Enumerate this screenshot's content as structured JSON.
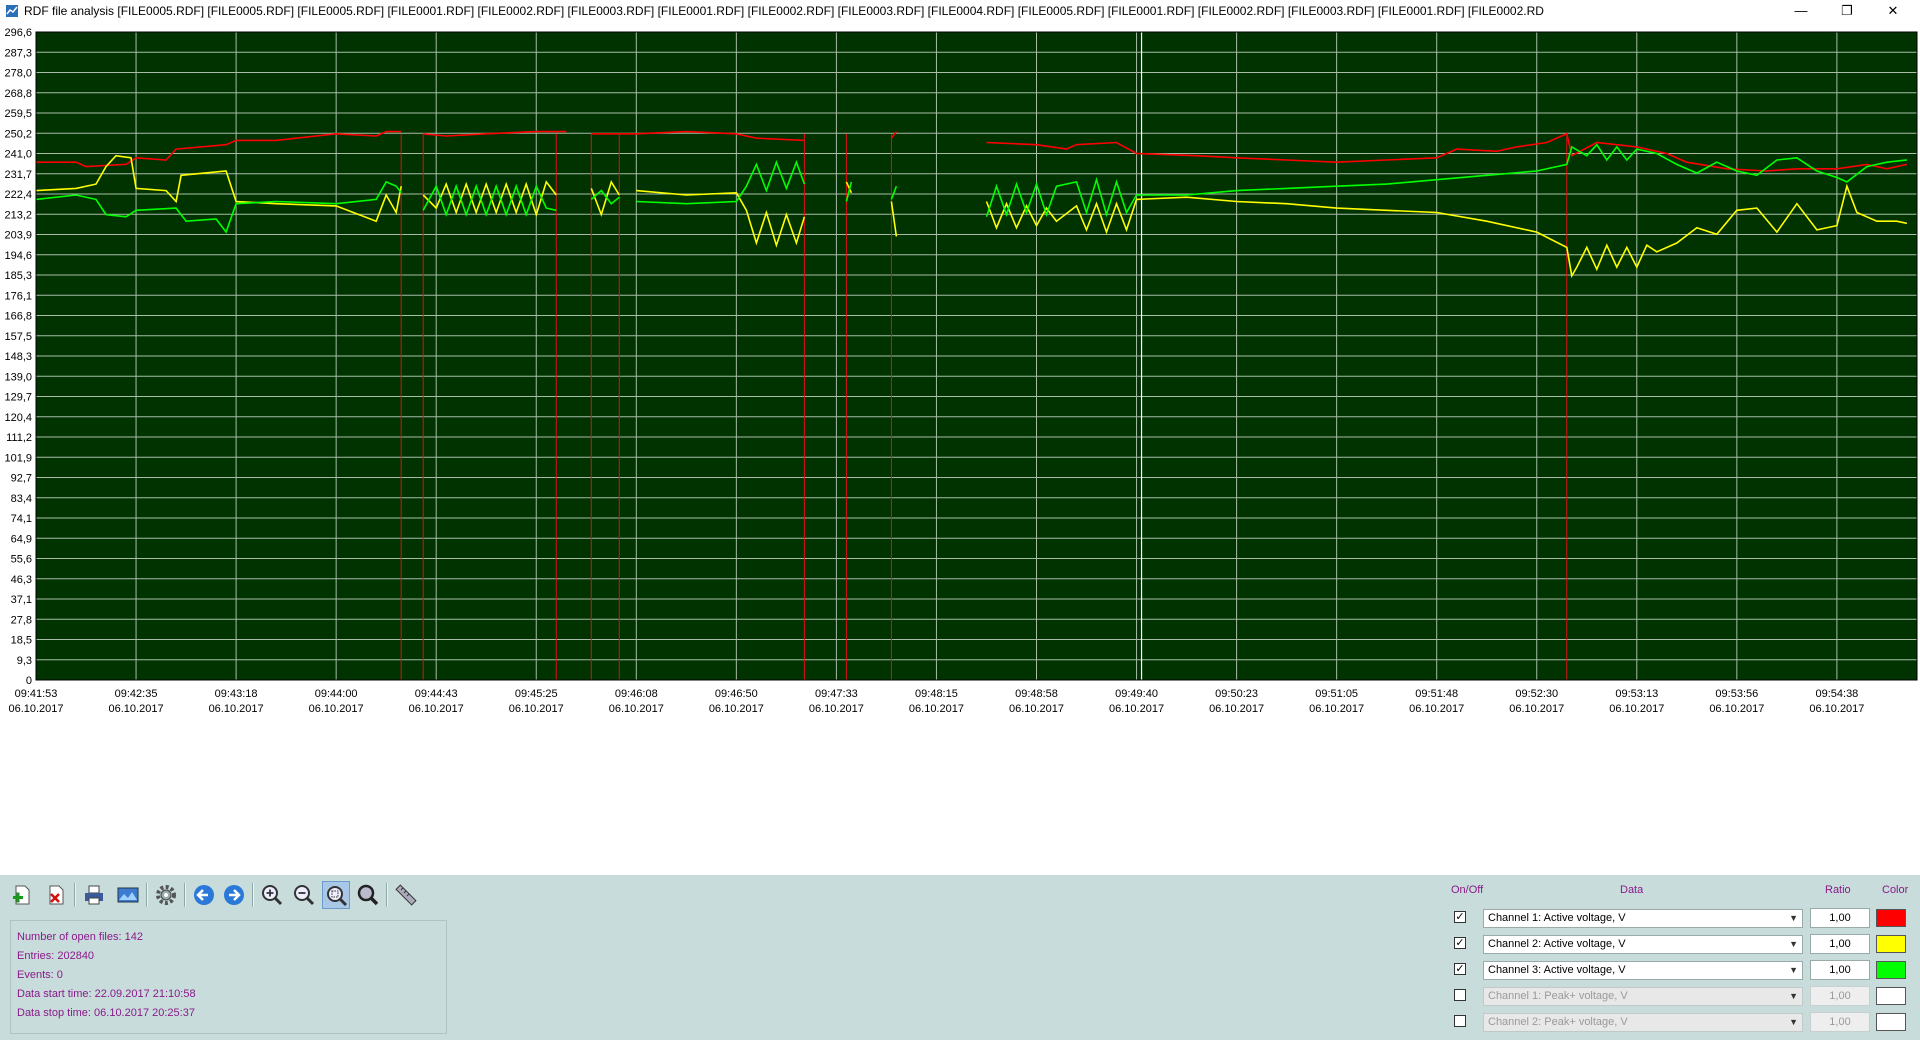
{
  "window": {
    "title": "RDF file analysis [FILE0005.RDF] [FILE0005.RDF] [FILE0005.RDF] [FILE0001.RDF] [FILE0002.RDF] [FILE0003.RDF] [FILE0001.RDF] [FILE0002.RDF] [FILE0003.RDF] [FILE0004.RDF] [FILE0005.RDF] [FILE0001.RDF] [FILE0002.RDF] [FILE0003.RDF] [FILE0001.RDF] [FILE0002.RD",
    "minimize_glyph": "—",
    "restore_glyph": "❐",
    "close_glyph": "✕"
  },
  "chart_data": {
    "type": "line",
    "background": "#003300",
    "grid": true,
    "grid_color": "#a8bca8",
    "ylim": [
      0,
      296.6
    ],
    "y_ticks": [
      "296,6",
      "287,3",
      "278,0",
      "268,8",
      "259,5",
      "250,2",
      "241,0",
      "231,7",
      "222,4",
      "213,2",
      "203,9",
      "194,6",
      "185,3",
      "176,1",
      "166,8",
      "157,5",
      "148,3",
      "139,0",
      "129,7",
      "120,4",
      "111,2",
      "101,9",
      "92,7",
      "83,4",
      "74,1",
      "64,9",
      "55,6",
      "46,3",
      "37,1",
      "27,8",
      "18,5",
      "9,3",
      "0"
    ],
    "x_ticks": [
      {
        "time": "09:41:53",
        "date": "06.10.2017"
      },
      {
        "time": "09:42:35",
        "date": "06.10.2017"
      },
      {
        "time": "09:43:18",
        "date": "06.10.2017"
      },
      {
        "time": "09:44:00",
        "date": "06.10.2017"
      },
      {
        "time": "09:44:43",
        "date": "06.10.2017"
      },
      {
        "time": "09:45:25",
        "date": "06.10.2017"
      },
      {
        "time": "09:46:08",
        "date": "06.10.2017"
      },
      {
        "time": "09:46:50",
        "date": "06.10.2017"
      },
      {
        "time": "09:47:33",
        "date": "06.10.2017"
      },
      {
        "time": "09:48:15",
        "date": "06.10.2017"
      },
      {
        "time": "09:48:58",
        "date": "06.10.2017"
      },
      {
        "time": "09:49:40",
        "date": "06.10.2017"
      },
      {
        "time": "09:50:23",
        "date": "06.10.2017"
      },
      {
        "time": "09:51:05",
        "date": "06.10.2017"
      },
      {
        "time": "09:51:48",
        "date": "06.10.2017"
      },
      {
        "time": "09:52:30",
        "date": "06.10.2017"
      },
      {
        "time": "09:53:13",
        "date": "06.10.2017"
      },
      {
        "time": "09:53:56",
        "date": "06.10.2017"
      },
      {
        "time": "09:54:38",
        "date": "06.10.2017"
      }
    ],
    "x_range_tick_units": [
      0,
      18.7
    ],
    "cursor_at_tick": 11.05,
    "event_markers_at_tick": [
      3.65,
      3.87,
      5.2,
      5.55,
      5.83,
      7.68,
      8.1,
      8.55,
      15.3
    ],
    "series": [
      {
        "name": "Channel 1: Active voltage, V",
        "color": "#ff0000",
        "points": [
          [
            0,
            237
          ],
          [
            0.4,
            237
          ],
          [
            0.5,
            235
          ],
          [
            0.9,
            236
          ],
          [
            1.0,
            239
          ],
          [
            1.3,
            238
          ],
          [
            1.4,
            243
          ],
          [
            1.9,
            245
          ],
          [
            2.0,
            247
          ],
          [
            2.4,
            247
          ],
          [
            2.6,
            248
          ],
          [
            3.0,
            250
          ],
          [
            3.4,
            249
          ],
          [
            3.5,
            251
          ],
          [
            3.65,
            251
          ],
          null,
          [
            3.87,
            250
          ],
          [
            4.1,
            249
          ],
          [
            4.5,
            250
          ],
          [
            5.0,
            251
          ],
          [
            5.3,
            251
          ],
          null,
          [
            5.55,
            250
          ],
          [
            6.0,
            250
          ],
          [
            6.5,
            251
          ],
          [
            7.0,
            250
          ],
          [
            7.2,
            248
          ],
          [
            7.68,
            247
          ],
          null,
          [
            8.55,
            248
          ],
          [
            8.6,
            251
          ],
          null,
          [
            9.5,
            246
          ],
          [
            10.0,
            245
          ],
          [
            10.3,
            243
          ],
          [
            10.4,
            245
          ],
          [
            10.8,
            246
          ],
          [
            11.0,
            241
          ],
          [
            11.6,
            240
          ],
          [
            12.0,
            239
          ],
          [
            12.5,
            238
          ],
          [
            13.0,
            237
          ],
          [
            13.5,
            238
          ],
          [
            14.0,
            239
          ],
          [
            14.2,
            243
          ],
          [
            14.6,
            242
          ],
          [
            14.8,
            244
          ],
          [
            15.1,
            246
          ],
          [
            15.3,
            250
          ],
          [
            15.35,
            240
          ],
          [
            15.6,
            246
          ],
          [
            16.0,
            244
          ],
          [
            16.3,
            241
          ],
          [
            16.5,
            237
          ],
          [
            16.9,
            234
          ],
          [
            17.3,
            233
          ],
          [
            17.6,
            234
          ],
          [
            18.0,
            234
          ],
          [
            18.3,
            236
          ],
          [
            18.5,
            234
          ],
          [
            18.7,
            236
          ]
        ]
      },
      {
        "name": "Channel 2: Active voltage, V",
        "color": "#ffff00",
        "points": [
          [
            0,
            224
          ],
          [
            0.4,
            225
          ],
          [
            0.6,
            227
          ],
          [
            0.7,
            235
          ],
          [
            0.8,
            240
          ],
          [
            0.95,
            239
          ],
          [
            1.0,
            225
          ],
          [
            1.3,
            224
          ],
          [
            1.4,
            219
          ],
          [
            1.45,
            231
          ],
          [
            1.9,
            233
          ],
          [
            2.0,
            219
          ],
          [
            2.4,
            218
          ],
          [
            3.0,
            217
          ],
          [
            3.4,
            210
          ],
          [
            3.5,
            222
          ],
          [
            3.6,
            214
          ],
          [
            3.65,
            226
          ],
          null,
          [
            3.87,
            222
          ],
          [
            4.0,
            216
          ],
          [
            4.1,
            227
          ],
          [
            4.2,
            214
          ],
          [
            4.3,
            227
          ],
          [
            4.4,
            214
          ],
          [
            4.5,
            227
          ],
          [
            4.6,
            214
          ],
          [
            4.7,
            227
          ],
          [
            4.8,
            214
          ],
          [
            4.9,
            227
          ],
          [
            5.0,
            213
          ],
          [
            5.1,
            228
          ],
          [
            5.2,
            222
          ],
          null,
          [
            5.55,
            225
          ],
          [
            5.65,
            213
          ],
          [
            5.75,
            228
          ],
          [
            5.83,
            222
          ],
          null,
          [
            6.0,
            224
          ],
          [
            6.5,
            222
          ],
          [
            7.0,
            223
          ],
          [
            7.1,
            215
          ],
          [
            7.2,
            200
          ],
          [
            7.3,
            214
          ],
          [
            7.4,
            199
          ],
          [
            7.5,
            213
          ],
          [
            7.6,
            200
          ],
          [
            7.68,
            212
          ],
          null,
          [
            8.1,
            228
          ],
          [
            8.15,
            223
          ],
          null,
          [
            8.55,
            219
          ],
          [
            8.6,
            203
          ],
          null,
          [
            9.5,
            219
          ],
          [
            9.6,
            207
          ],
          [
            9.7,
            218
          ],
          [
            9.8,
            207
          ],
          [
            9.9,
            217
          ],
          [
            10.0,
            208
          ],
          [
            10.1,
            216
          ],
          [
            10.2,
            210
          ],
          [
            10.4,
            217
          ],
          [
            10.5,
            206
          ],
          [
            10.6,
            218
          ],
          [
            10.7,
            205
          ],
          [
            10.8,
            218
          ],
          [
            10.9,
            206
          ],
          [
            11.0,
            220
          ],
          [
            11.5,
            221
          ],
          [
            12.0,
            219
          ],
          [
            12.5,
            218
          ],
          [
            13.0,
            216
          ],
          [
            13.5,
            215
          ],
          [
            14.0,
            214
          ],
          [
            14.5,
            210
          ],
          [
            15.0,
            205
          ],
          [
            15.3,
            198
          ],
          [
            15.35,
            185
          ],
          [
            15.4,
            189
          ],
          [
            15.5,
            198
          ],
          [
            15.6,
            188
          ],
          [
            15.7,
            199
          ],
          [
            15.8,
            189
          ],
          [
            15.9,
            198
          ],
          [
            16.0,
            189
          ],
          [
            16.1,
            199
          ],
          [
            16.2,
            196
          ],
          [
            16.4,
            200
          ],
          [
            16.6,
            207
          ],
          [
            16.8,
            204
          ],
          [
            17.0,
            215
          ],
          [
            17.2,
            216
          ],
          [
            17.4,
            205
          ],
          [
            17.6,
            218
          ],
          [
            17.8,
            206
          ],
          [
            18.0,
            208
          ],
          [
            18.1,
            226
          ],
          [
            18.2,
            214
          ],
          [
            18.4,
            210
          ],
          [
            18.6,
            210
          ],
          [
            18.7,
            209
          ]
        ]
      },
      {
        "name": "Channel 3: Active voltage, V",
        "color": "#00ff00",
        "points": [
          [
            0,
            220
          ],
          [
            0.4,
            222
          ],
          [
            0.6,
            220
          ],
          [
            0.7,
            213
          ],
          [
            0.9,
            212
          ],
          [
            1.0,
            215
          ],
          [
            1.4,
            216
          ],
          [
            1.5,
            210
          ],
          [
            1.8,
            211
          ],
          [
            1.9,
            205
          ],
          [
            2.0,
            218
          ],
          [
            2.4,
            219
          ],
          [
            3.0,
            218
          ],
          [
            3.4,
            220
          ],
          [
            3.5,
            228
          ],
          [
            3.6,
            226
          ],
          [
            3.65,
            223
          ],
          null,
          [
            3.87,
            215
          ],
          [
            4.0,
            226
          ],
          [
            4.1,
            213
          ],
          [
            4.2,
            226
          ],
          [
            4.3,
            213
          ],
          [
            4.4,
            226
          ],
          [
            4.5,
            213
          ],
          [
            4.6,
            226
          ],
          [
            4.7,
            213
          ],
          [
            4.8,
            226
          ],
          [
            4.9,
            213
          ],
          [
            5.0,
            226
          ],
          [
            5.1,
            216
          ],
          [
            5.2,
            215
          ],
          null,
          [
            5.55,
            220
          ],
          [
            5.65,
            224
          ],
          [
            5.75,
            218
          ],
          [
            5.83,
            221
          ],
          null,
          [
            6.0,
            219
          ],
          [
            6.5,
            218
          ],
          [
            7.0,
            219
          ],
          [
            7.1,
            226
          ],
          [
            7.2,
            236
          ],
          [
            7.3,
            224
          ],
          [
            7.4,
            237
          ],
          [
            7.5,
            225
          ],
          [
            7.6,
            237
          ],
          [
            7.68,
            227
          ],
          null,
          [
            8.1,
            219
          ],
          [
            8.15,
            228
          ],
          null,
          [
            8.55,
            220
          ],
          [
            8.6,
            226
          ],
          null,
          [
            9.5,
            212
          ],
          [
            9.6,
            226
          ],
          [
            9.7,
            213
          ],
          [
            9.8,
            227
          ],
          [
            9.9,
            214
          ],
          [
            10.0,
            227
          ],
          [
            10.1,
            213
          ],
          [
            10.2,
            226
          ],
          [
            10.4,
            228
          ],
          [
            10.5,
            214
          ],
          [
            10.6,
            229
          ],
          [
            10.7,
            213
          ],
          [
            10.8,
            228
          ],
          [
            10.9,
            214
          ],
          [
            11.0,
            222
          ],
          [
            11.5,
            222
          ],
          [
            12.0,
            224
          ],
          [
            12.5,
            225
          ],
          [
            13.0,
            226
          ],
          [
            13.5,
            227
          ],
          [
            14.0,
            229
          ],
          [
            14.5,
            231
          ],
          [
            15.0,
            233
          ],
          [
            15.3,
            236
          ],
          [
            15.35,
            244
          ],
          [
            15.5,
            240
          ],
          [
            15.6,
            245
          ],
          [
            15.7,
            238
          ],
          [
            15.8,
            244
          ],
          [
            15.9,
            238
          ],
          [
            16.0,
            243
          ],
          [
            16.2,
            241
          ],
          [
            16.4,
            236
          ],
          [
            16.6,
            232
          ],
          [
            16.8,
            237
          ],
          [
            17.0,
            233
          ],
          [
            17.2,
            231
          ],
          [
            17.4,
            238
          ],
          [
            17.6,
            239
          ],
          [
            17.8,
            233
          ],
          [
            18.0,
            230
          ],
          [
            18.1,
            228
          ],
          [
            18.3,
            235
          ],
          [
            18.5,
            237
          ],
          [
            18.7,
            238
          ]
        ]
      }
    ]
  },
  "toolbar": {
    "buttons": [
      "add-file",
      "delete-file",
      "print",
      "export",
      "settings",
      "back",
      "forward",
      "zoom-in",
      "zoom-out",
      "zoom-area",
      "zoom-fit",
      "measure"
    ]
  },
  "info": {
    "open_files": "Number of open files: 142",
    "entries": "Entries: 202840",
    "events": "Events: 0",
    "start": "Data start time: 22.09.2017 21:10:58",
    "stop": "Data stop time: 06.10.2017 20:25:37"
  },
  "channels_panel": {
    "headers": {
      "onoff": "On/Off",
      "data": "Data",
      "ratio": "Ratio",
      "color": "Color"
    },
    "rows": [
      {
        "checked": true,
        "label": "Channel 1: Active voltage, V",
        "ratio": "1,00",
        "color": "#ff0000",
        "enabled": true
      },
      {
        "checked": true,
        "label": "Channel 2: Active voltage, V",
        "ratio": "1,00",
        "color": "#ffff00",
        "enabled": true
      },
      {
        "checked": true,
        "label": "Channel 3: Active voltage, V",
        "ratio": "1,00",
        "color": "#00ff00",
        "enabled": true
      },
      {
        "checked": false,
        "label": "Channel 1: Peak+ voltage, V",
        "ratio": "1,00",
        "color": "#ffffff",
        "enabled": false
      },
      {
        "checked": false,
        "label": "Channel 2: Peak+ voltage, V",
        "ratio": "1,00",
        "color": "#ffffff",
        "enabled": false
      }
    ]
  }
}
